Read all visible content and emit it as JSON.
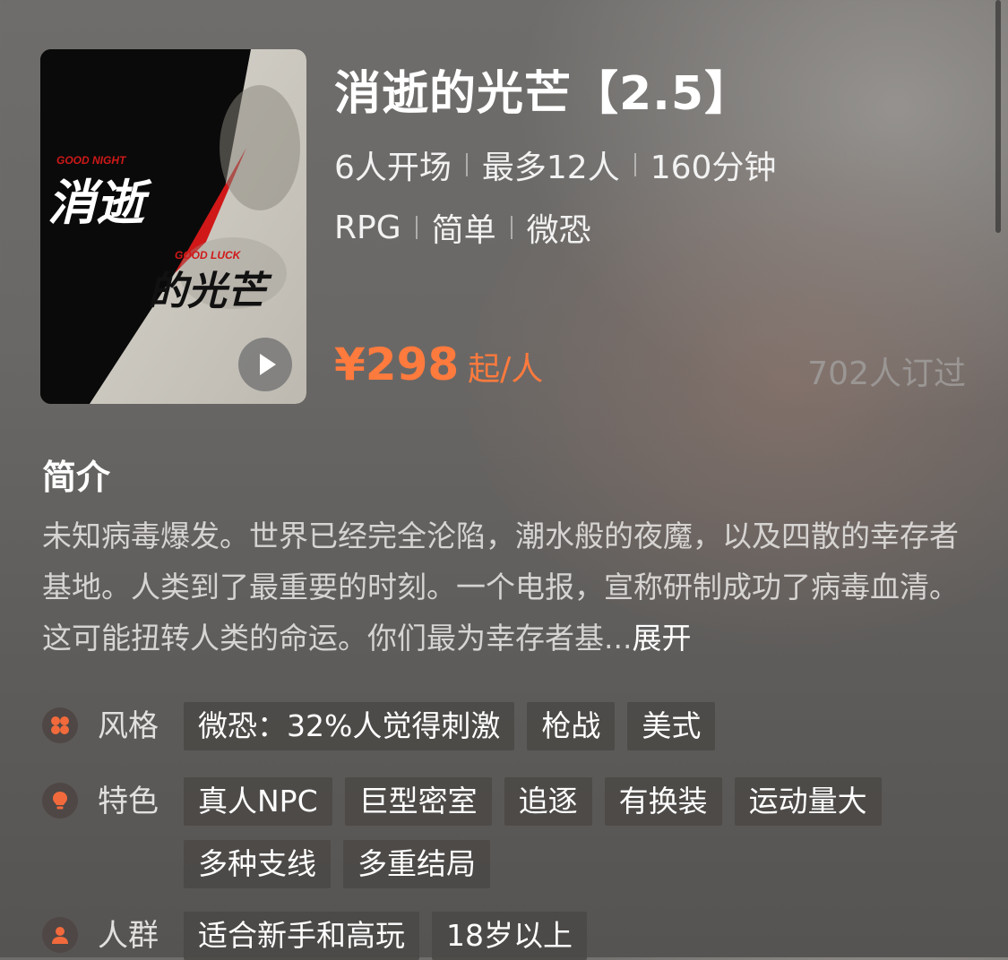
{
  "cover": {
    "tagline_1": "GOOD NIGHT",
    "tagline_2": "GOOD LUCK",
    "art_title_1": "消逝",
    "art_title_2": "的光芒",
    "play_icon": "play-icon"
  },
  "header": {
    "title": "消逝的光芒【2.5】",
    "meta": [
      "6人开场",
      "最多12人",
      "160分钟"
    ],
    "tags": [
      "RPG",
      "简单",
      "微恐"
    ]
  },
  "price": {
    "amount": "¥298",
    "unit": "起/人",
    "booked": "702人订过"
  },
  "intro": {
    "heading": "简介",
    "text": "未知病毒爆发。世界已经完全沦陷，潮水般的夜魔，以及四散的幸存者基地。人类到了最重要的时刻。一个电报，宣称研制成功了病毒血清。这可能扭转人类的命运。你们最为幸存者基...",
    "expand_label": "展开"
  },
  "attributes": [
    {
      "icon": "style-icon",
      "label": "风格",
      "tags": [
        "微恐：32%人觉得刺激",
        "枪战",
        "美式"
      ]
    },
    {
      "icon": "feature-icon",
      "label": "特色",
      "tags": [
        "真人NPC",
        "巨型密室",
        "追逐",
        "有换装",
        "运动量大",
        "多种支线",
        "多重结局"
      ]
    },
    {
      "icon": "audience-icon",
      "label": "人群",
      "tags": [
        "适合新手和高玩",
        "18岁以上"
      ]
    }
  ],
  "colors": {
    "accent": "#ff7a3d",
    "icon": "#f26a3c"
  }
}
